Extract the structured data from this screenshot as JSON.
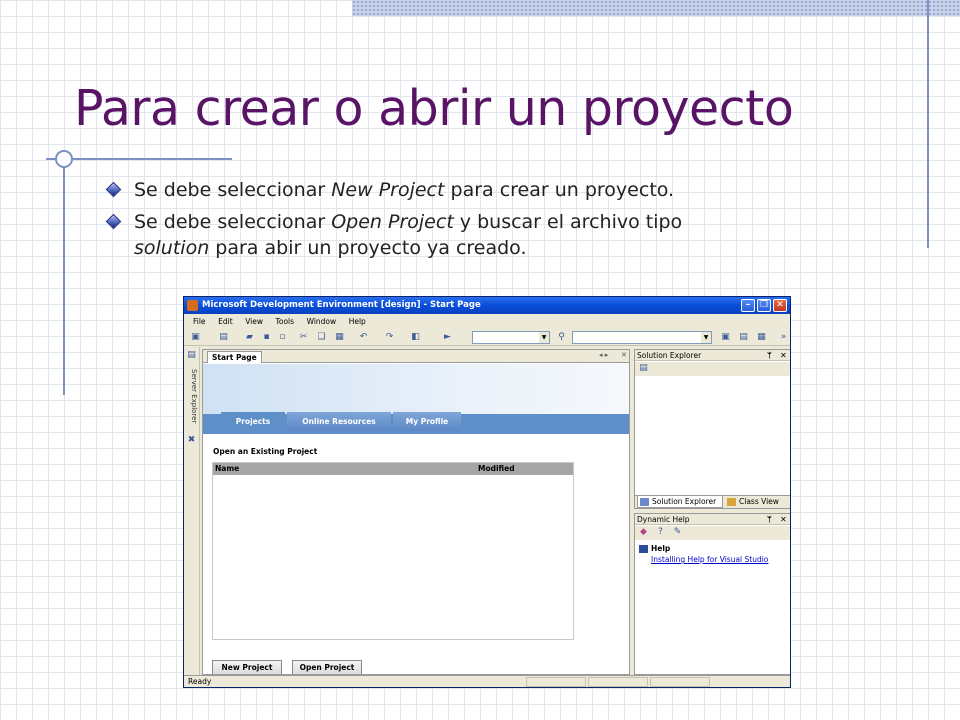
{
  "slide": {
    "title": "Para crear o abrir un proyecto",
    "bullets": [
      {
        "pre": "Se debe seleccionar ",
        "em": "New Project",
        "post": " para crear un proyecto."
      },
      {
        "pre": "Se debe seleccionar ",
        "em": "Open Project",
        "mid": " y buscar el archivo tipo ",
        "em2": "solution",
        "post": " para abir un proyecto ya creado."
      }
    ]
  },
  "app": {
    "window_title": "Microsoft Development Environment [design] - Start Page",
    "menu": [
      "File",
      "Edit",
      "View",
      "Tools",
      "Window",
      "Help"
    ],
    "side_tab": "Server Explorer",
    "doc_tab": "Start Page",
    "start_page": {
      "tabs": [
        "Projects",
        "Online Resources",
        "My Profile"
      ],
      "heading": "Open an Existing Project",
      "columns": [
        "Name",
        "Modified"
      ],
      "buttons": {
        "new": "New Project",
        "open": "Open Project"
      }
    },
    "solution_explorer": {
      "title": "Solution Explorer",
      "tabs": [
        "Solution Explorer",
        "Class View"
      ]
    },
    "dynamic_help": {
      "title": "Dynamic Help",
      "section": "Help",
      "link": "Installing Help for Visual Studio"
    },
    "status": "Ready",
    "colors": {
      "title_text": "#5a1466",
      "titlebar": "#0a4ed8",
      "accent": "#5e8fc9"
    }
  }
}
